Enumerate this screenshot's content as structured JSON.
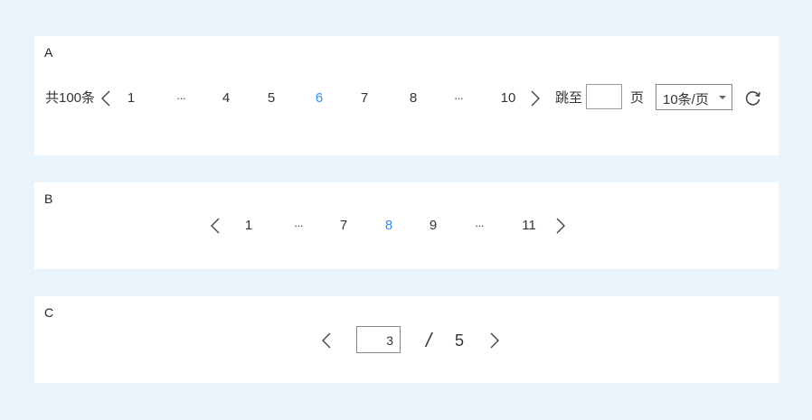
{
  "section_a": {
    "label": "A",
    "total": "共100条",
    "pages": [
      "1",
      "···",
      "4",
      "5",
      "6",
      "7",
      "8",
      "···",
      "10"
    ],
    "current": "6",
    "jump_label": "跳至",
    "jump_value": "",
    "page_suffix": "页",
    "page_size": "10条/页",
    "icons": [
      "chevron-left-icon",
      "chevron-right-icon",
      "refresh-icon",
      "caret-down-icon"
    ],
    "accent_color": "#3c8ce7"
  },
  "section_b": {
    "label": "B",
    "pages": [
      "1",
      "···",
      "7",
      "8",
      "9",
      "···",
      "11"
    ],
    "current": "8",
    "icons": [
      "chevron-left-icon",
      "chevron-right-icon"
    ]
  },
  "section_c": {
    "label": "C",
    "current_page": "3",
    "separator": "/",
    "total_pages": "5",
    "icons": [
      "chevron-left-icon",
      "chevron-right-icon"
    ]
  }
}
